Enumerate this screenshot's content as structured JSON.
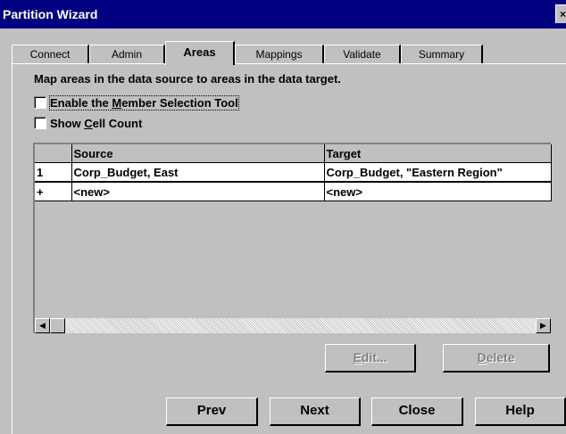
{
  "window": {
    "title": "Partition Wizard",
    "close_glyph": "×"
  },
  "tabs": [
    {
      "label": "Connect"
    },
    {
      "label": "Admin"
    },
    {
      "label": "Areas",
      "active": true
    },
    {
      "label": "Mappings"
    },
    {
      "label": "Validate"
    },
    {
      "label": "Summary"
    }
  ],
  "instruction": "Map areas in the data source to areas in the data target.",
  "options": {
    "member_tool": {
      "pre": "Enable the ",
      "u": "M",
      "post": "ember Selection Tool",
      "checked": false
    },
    "cell_count": {
      "pre": "Show ",
      "u": "C",
      "post": "ell Count",
      "checked": false
    }
  },
  "grid": {
    "headers": {
      "source": "Source",
      "target": "Target"
    },
    "rows": [
      {
        "num": "1",
        "source": "Corp_Budget, East",
        "target": "Corp_Budget, \"Eastern Region\""
      },
      {
        "num": "+",
        "source": "<new>",
        "target": "<new>"
      }
    ],
    "scroll_left_glyph": "◀",
    "scroll_right_glyph": "▶"
  },
  "buttons": {
    "edit": {
      "u": "E",
      "rest": "dit..."
    },
    "delete": {
      "u": "D",
      "rest": "elete"
    },
    "prev": "Prev",
    "next": "Next",
    "close": "Close",
    "help": "Help"
  }
}
